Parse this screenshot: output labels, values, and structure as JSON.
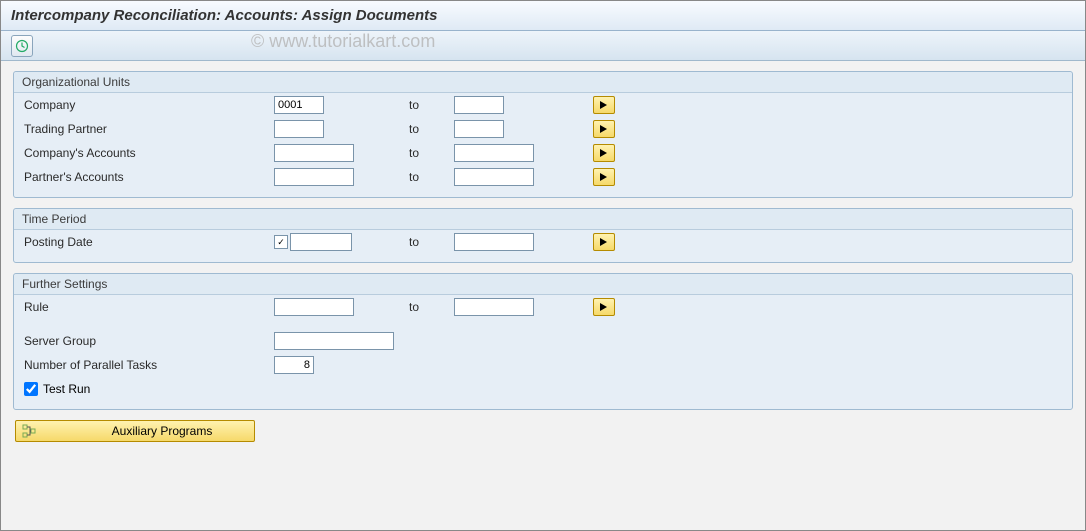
{
  "title": "Intercompany Reconciliation: Accounts: Assign Documents",
  "watermark": "© www.tutorialkart.com",
  "groups": {
    "org": {
      "title": "Organizational Units",
      "company": {
        "label": "Company",
        "from": "0001",
        "to": "",
        "to_label": "to"
      },
      "trading": {
        "label": "Trading Partner",
        "from": "",
        "to": "",
        "to_label": "to"
      },
      "compacc": {
        "label": "Company's Accounts",
        "from": "",
        "to": "",
        "to_label": "to"
      },
      "partacc": {
        "label": "Partner's Accounts",
        "from": "",
        "to": "",
        "to_label": "to"
      }
    },
    "time": {
      "title": "Time Period",
      "posting": {
        "label": "Posting Date",
        "from": "",
        "to": "",
        "to_label": "to"
      }
    },
    "further": {
      "title": "Further Settings",
      "rule": {
        "label": "Rule",
        "from": "",
        "to": "",
        "to_label": "to"
      },
      "server": {
        "label": "Server Group",
        "value": ""
      },
      "parallel": {
        "label": "Number of Parallel Tasks",
        "value": "8"
      },
      "testrun": {
        "label": "Test Run",
        "checked": true
      }
    }
  },
  "aux_button": "Auxiliary Programs"
}
